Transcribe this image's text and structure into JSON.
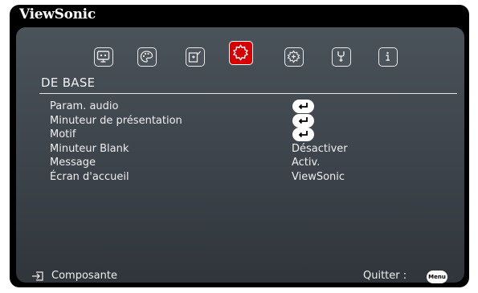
{
  "brand": "ViewSonic",
  "tabs": [
    {
      "icon": "display-icon",
      "active": false
    },
    {
      "icon": "picture-icon",
      "active": false
    },
    {
      "icon": "source-icon",
      "active": false
    },
    {
      "icon": "basic-settings-icon",
      "active": true
    },
    {
      "icon": "advanced-settings-icon",
      "active": false
    },
    {
      "icon": "system-icon",
      "active": false
    },
    {
      "icon": "information-icon",
      "active": false
    }
  ],
  "tab_title": "DE BASE",
  "settings": [
    {
      "label": "Param. audio",
      "value": null,
      "control": "enter-icon"
    },
    {
      "label": "Minuteur de présentation",
      "value": null,
      "control": "enter-icon"
    },
    {
      "label": "Motif",
      "value": null,
      "control": "enter-icon"
    },
    {
      "label": "Minuteur Blank",
      "value": "Désactiver"
    },
    {
      "label": "Message",
      "value": "Activ."
    },
    {
      "label": "Écran d'accueil",
      "value": "ViewSonic"
    }
  ],
  "footer": {
    "source_icon": "input-source-icon",
    "source": "Composante",
    "quit": "Quitter  :",
    "menu_button": "Menu"
  },
  "colors": {
    "active_tab": "#d60000",
    "panel_top": "#4a525a",
    "panel_bottom": "#2f353b",
    "text": "#eeeeee"
  }
}
